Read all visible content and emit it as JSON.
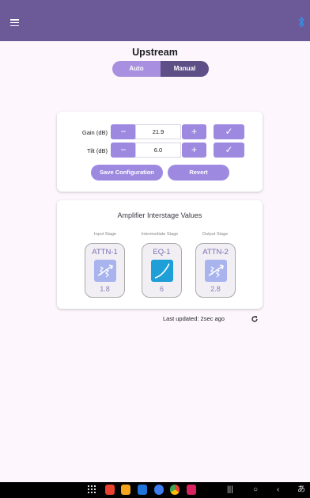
{
  "header": {
    "title": "Upstream"
  },
  "mode_toggle": {
    "auto_label": "Auto",
    "manual_label": "Manual",
    "selected": "Manual"
  },
  "config": {
    "gain": {
      "label": "Gain (dB)",
      "value": "21.9"
    },
    "tilt": {
      "label": "Tilt (dB)",
      "value": "6.0"
    },
    "minus_symbol": "−",
    "plus_symbol": "+",
    "check_symbol": "✓",
    "save_label": "Save Configuration",
    "revert_label": "Revert"
  },
  "interstage": {
    "title": "Amplifier Interstage Values",
    "stages": [
      {
        "caption": "Input Stage",
        "name": "ATTN-1",
        "value": "1.8",
        "icon": "attenuator-icon"
      },
      {
        "caption": "Intermediate Stage",
        "name": "EQ-1",
        "value": "6",
        "icon": "equalizer-curve-icon"
      },
      {
        "caption": "Output Stage",
        "name": "ATTN-2",
        "value": "2.8",
        "icon": "attenuator-icon"
      }
    ]
  },
  "status": {
    "last_updated": "Last updated: 2sec ago"
  },
  "nav": {
    "recents_glyph": "|||",
    "home_glyph": "○",
    "back_glyph": "‹",
    "ime_glyph": "あ"
  },
  "colors": {
    "app_bar": "#6c5a98",
    "accent": "#9d8ae0",
    "toggle_selected": "#5e5086",
    "toggle_unselected": "#a98fe0",
    "bluetooth": "#2f8fe6",
    "eq_tile": "#1e9fd8"
  }
}
